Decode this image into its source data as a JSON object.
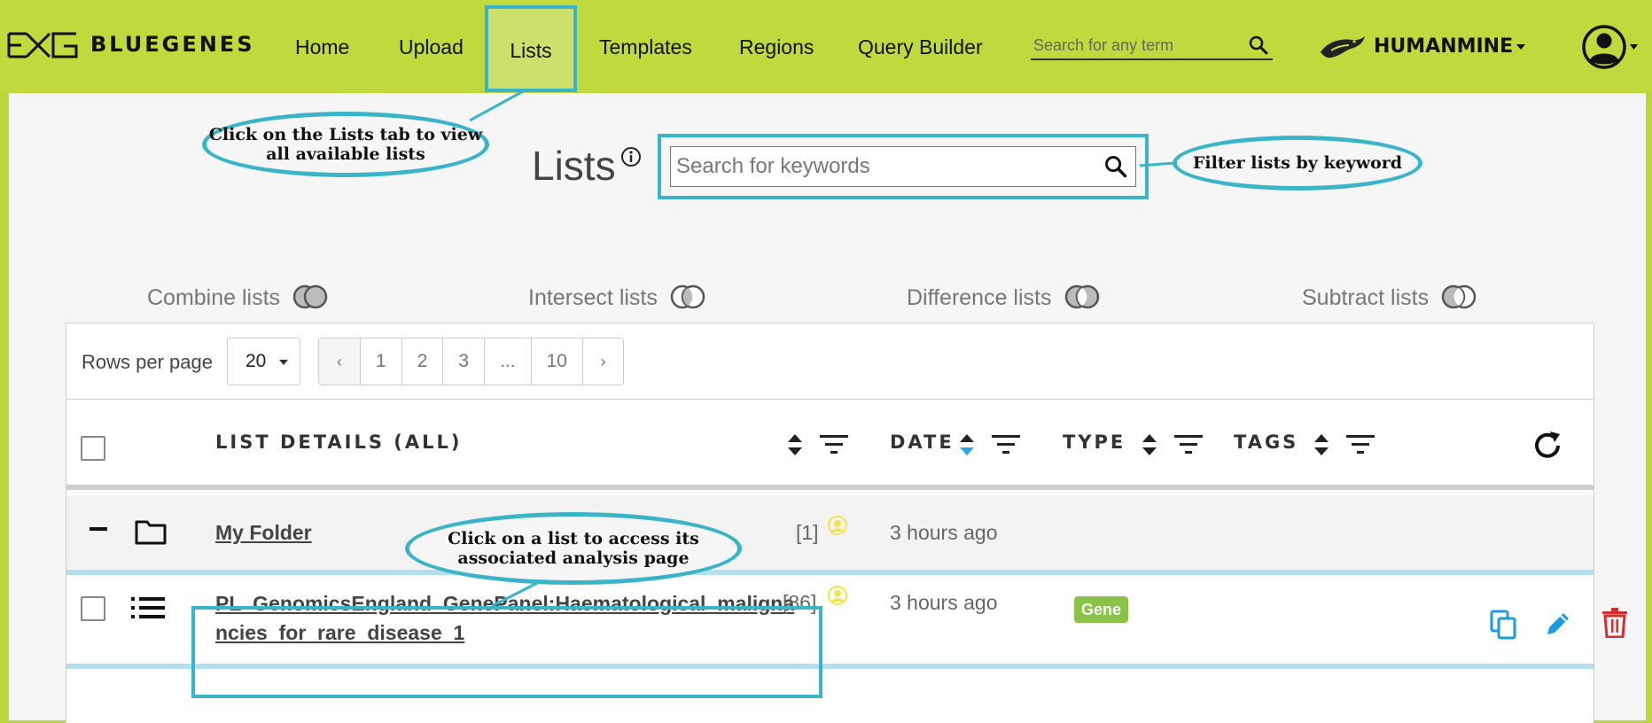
{
  "brand": {
    "name": "BLUEGENES"
  },
  "nav": {
    "items": [
      {
        "label": "Home",
        "active": false
      },
      {
        "label": "Upload",
        "active": false
      },
      {
        "label": "Lists",
        "active": true
      },
      {
        "label": "Templates",
        "active": false
      },
      {
        "label": "Regions",
        "active": false
      },
      {
        "label": "Query Builder",
        "active": false
      }
    ],
    "search_placeholder": "Search for any term",
    "mine_name": "HUMANMINE"
  },
  "page": {
    "title": "Lists",
    "filter_placeholder": "Search for keywords"
  },
  "operations": [
    "Combine lists",
    "Intersect lists",
    "Difference lists",
    "Subtract lists"
  ],
  "pagination": {
    "rows_label": "Rows per page",
    "rows_value": "20",
    "prev": "‹",
    "pages": [
      "1",
      "2",
      "3",
      "...",
      "10"
    ],
    "next": "›"
  },
  "table": {
    "columns": [
      "LIST DETAILS (ALL)",
      "DATE",
      "TYPE",
      "TAGS"
    ],
    "folder": {
      "name": "My Folder",
      "count": "[1]",
      "date": "3 hours ago"
    },
    "list": {
      "name_line1": "PL_GenomicsEngland_GenePanel:Haematological_maligna",
      "name_line2": "ncies_for_rare_disease_1",
      "count": "[86]",
      "date": "3 hours ago",
      "type": "Gene"
    }
  },
  "callouts": {
    "lists_tab": "Click on the Lists tab to view all available lists",
    "filter": "Filter lists by keyword",
    "list_click": "Click on a list to access its associated analysis page"
  },
  "colors": {
    "navbar": "#c0da3e",
    "callout_border": "#3ab4c9",
    "gene_badge": "#8bc34a",
    "sort_active": "#2aa7e0",
    "edit_icon": "#1e9be0",
    "delete_icon": "#d32f2f",
    "owner_icon": "#f3e44b"
  },
  "icons": [
    "search-icon",
    "info-icon",
    "venn-icon",
    "sort-icon",
    "filter-icon",
    "refresh-icon",
    "folder-icon",
    "list-icon",
    "user-icon",
    "copy-icon",
    "edit-icon",
    "delete-icon",
    "account-icon"
  ]
}
